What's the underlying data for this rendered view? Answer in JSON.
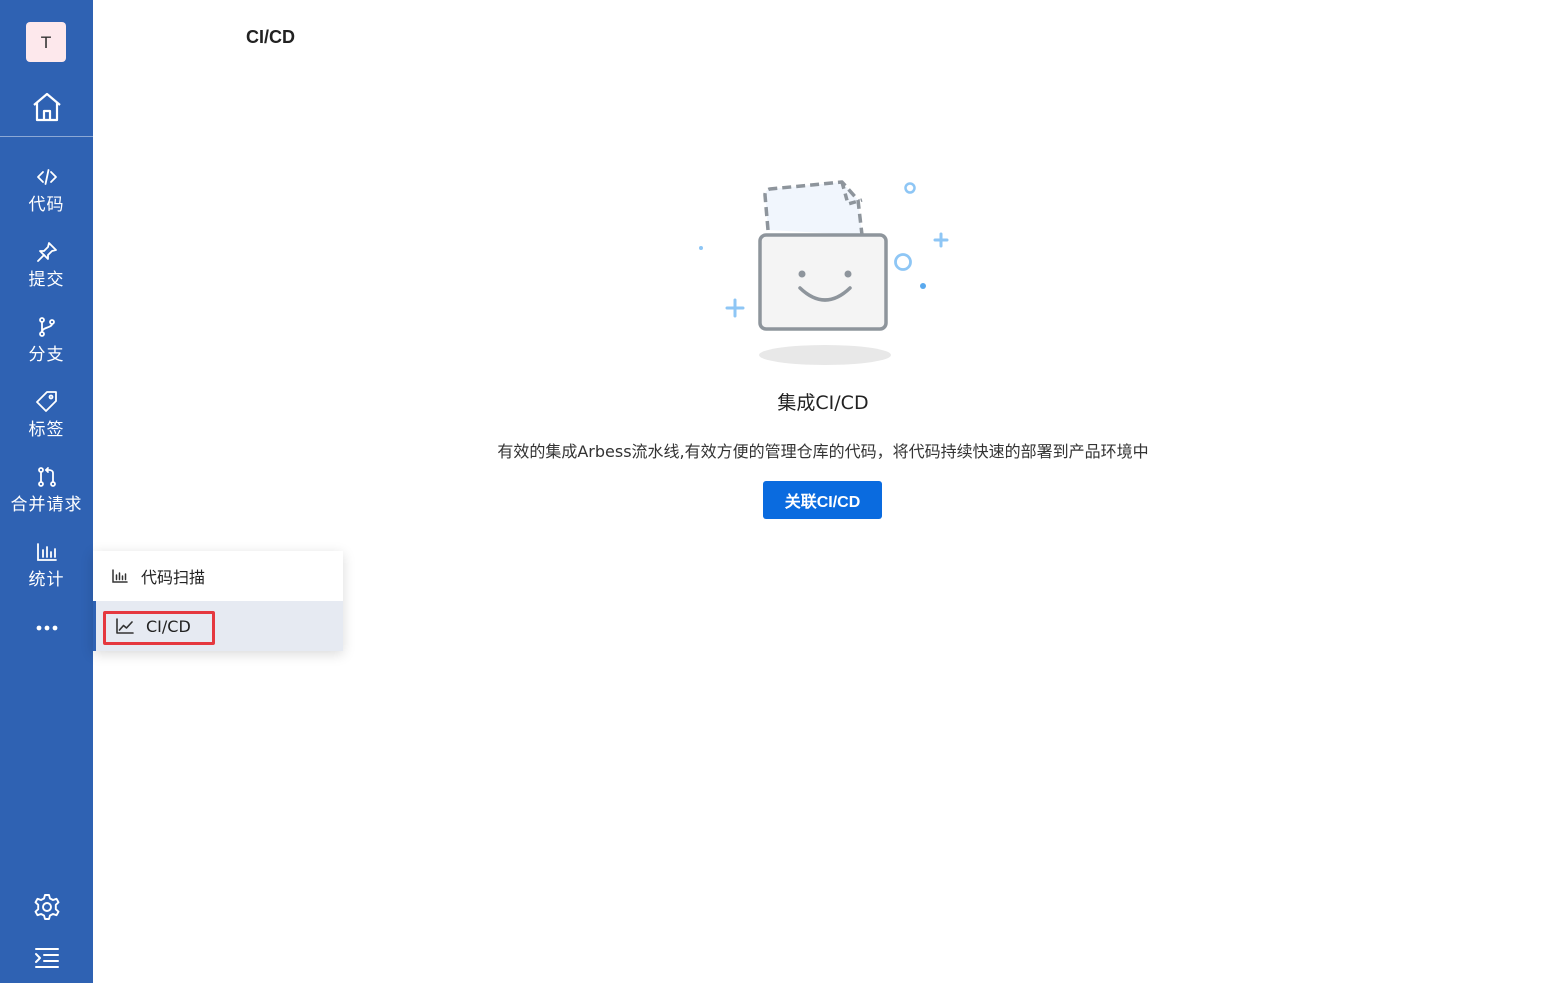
{
  "sidebar": {
    "avatar_letter": "T",
    "items": [
      {
        "label": "代码",
        "icon": "code-icon"
      },
      {
        "label": "提交",
        "icon": "pin-icon"
      },
      {
        "label": "分支",
        "icon": "branch-icon"
      },
      {
        "label": "标签",
        "icon": "tag-icon"
      },
      {
        "label": "合并请求",
        "icon": "merge-request-icon"
      },
      {
        "label": "统计",
        "icon": "bar-chart-icon"
      }
    ],
    "more_icon": "more-icon",
    "settings_icon": "gear-icon",
    "collapse_icon": "collapse-menu-icon"
  },
  "header": {
    "title": "CI/CD"
  },
  "empty_state": {
    "title": "集成CI/CD",
    "description": "有效的集成Arbess流水线,有效方便的管理仓库的代码，将代码持续快速的部署到产品环境中",
    "button_label": "关联CI/CD"
  },
  "popup_menu": {
    "items": [
      {
        "label": "代码扫描",
        "icon": "bar-chart-icon"
      },
      {
        "label": "CI/CD",
        "icon": "line-chart-icon",
        "selected": true
      }
    ]
  },
  "colors": {
    "sidebar_bg": "#2f62b3",
    "primary_button": "#0a6bdf",
    "highlight_border": "#e5383f"
  }
}
